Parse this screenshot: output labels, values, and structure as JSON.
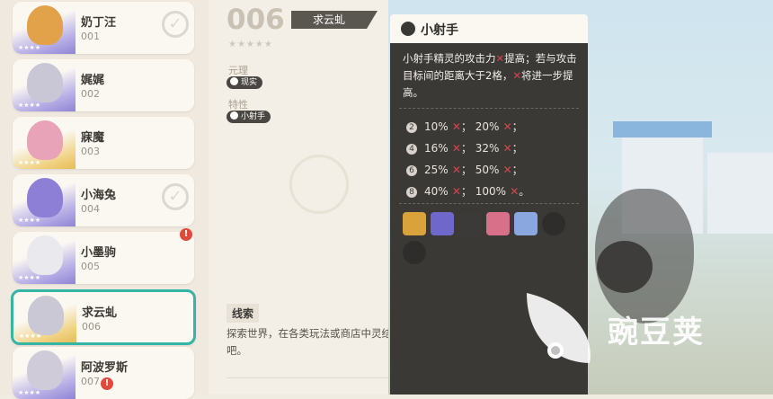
{
  "cards": [
    {
      "name": "奶丁汪",
      "num": "001",
      "checked": true,
      "alert": false,
      "rarity": "purple"
    },
    {
      "name": "娓娓",
      "num": "002",
      "checked": false,
      "alert": false,
      "rarity": "purple"
    },
    {
      "name": "寐魔",
      "num": "003",
      "checked": false,
      "alert": false,
      "rarity": "gold"
    },
    {
      "name": "小海兔",
      "num": "004",
      "checked": true,
      "alert": false,
      "rarity": "purple"
    },
    {
      "name": "小墨驹",
      "num": "005",
      "checked": false,
      "alert": true,
      "rarity": "purple"
    },
    {
      "name": "求云虬",
      "num": "006",
      "checked": false,
      "alert": false,
      "rarity": "gold",
      "selected": true
    },
    {
      "name": "阿波罗斯",
      "num": "007",
      "checked": false,
      "alert": true,
      "rarity": "purple"
    }
  ],
  "detail": {
    "number": "006",
    "name": "求云虬",
    "stars": "★★★★★",
    "element_label": "元理",
    "element_value": "现实",
    "trait_label": "特性",
    "trait_value": "小射手",
    "clue_title": "线索",
    "clue_text": "探索世界，在各类玩法或商店中灵结缘吧。"
  },
  "popup": {
    "title": "小射手",
    "desc_1": "小射手精灵的攻击力",
    "desc_2": "提高；若与攻击目标间的距离大于2格，",
    "desc_3": "将进一步提高。",
    "levels": [
      {
        "n": "2",
        "a": "10%",
        "b": "20%",
        "end": "；"
      },
      {
        "n": "4",
        "a": "16%",
        "b": "32%",
        "end": "；"
      },
      {
        "n": "6",
        "a": "25%",
        "b": "50%",
        "end": "；"
      },
      {
        "n": "8",
        "a": "40%",
        "b": "100%",
        "end": "。"
      }
    ],
    "avatar_colors": [
      "#d9a23a",
      "#6f67c9",
      "#3c3a38",
      "#d9708a",
      "#8aa7e0",
      "#2e2c2a",
      "#2e2c2a"
    ]
  },
  "watermark": {
    "text": "豌豆荚"
  }
}
